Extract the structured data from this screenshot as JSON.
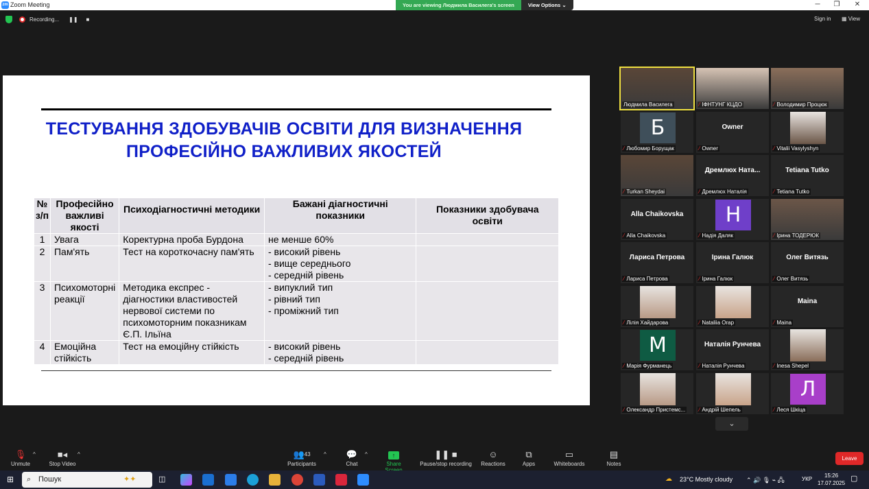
{
  "window": {
    "title": "Zoom Meeting",
    "logo": "zm",
    "minimize": "─",
    "restore": "❐",
    "close": "✕"
  },
  "viewing_banner": {
    "text": "You are viewing Людмила Василега's screen",
    "view_options": "View Options"
  },
  "top": {
    "recording": "Recording...",
    "sign_in": "Sign in",
    "view": "View"
  },
  "slide": {
    "title_line1": "ТЕСТУВАННЯ ЗДОБУВАЧІВ ОСВІТИ ДЛЯ ВИЗНАЧЕННЯ",
    "title_line2": "ПРОФЕСІЙНО ВАЖЛИВИХ ЯКОСТЕЙ",
    "headers": [
      "№ з/п",
      "Професійно важливі якості",
      "Психодіагностичні методики",
      "Бажані діагностичні показники",
      "Показники здобувача освіти"
    ],
    "rows": [
      {
        "n": "1",
        "quality": "Увага",
        "method": "Коректурна проба Бурдона",
        "target": "не менше 60%",
        "result": ""
      },
      {
        "n": "2",
        "quality": "Пам'ять",
        "method": "Тест на короткочасну пам'ять",
        "target": "- високий рівень\n- вище середнього\n- середній рівень",
        "result": ""
      },
      {
        "n": "3",
        "quality": "Психомоторні реакції",
        "method": "Методика експрес - діагностики властивостей нервової системи по психомоторним показникам Є.П. Ільїна",
        "target": "- випуклий тип\n- рівний тип\n- проміжний тип",
        "result": ""
      },
      {
        "n": "4",
        "quality": "Емоційна стійкість",
        "method": "Тест на емоційну стійкість",
        "target": "- високий рівень\n- середній рівень",
        "result": ""
      }
    ]
  },
  "participants_gallery": [
    {
      "name": "Людмила Василега",
      "type": "video",
      "active": true,
      "muted": false
    },
    {
      "name": "ІФНТУНГ КЦДО",
      "type": "video",
      "muted": true
    },
    {
      "name": "Володимир Процюк",
      "type": "video",
      "muted": true
    },
    {
      "name": "Любомир Борущак",
      "type": "avatar",
      "letter": "Б",
      "color": "#3f4f5a",
      "muted": true
    },
    {
      "name": "Owner",
      "type": "name",
      "big": "Owner",
      "muted": true
    },
    {
      "name": "Vitalii Vasylyshyn",
      "type": "photo",
      "muted": true
    },
    {
      "name": "Turkan Sheydai",
      "type": "video",
      "muted": true
    },
    {
      "name": "Дремлюх Наталія",
      "type": "name",
      "big": "Дремлюх  Ната...",
      "muted": true
    },
    {
      "name": "Tetiana Tutko",
      "type": "name",
      "big": "Tetiana Tutko",
      "muted": true
    },
    {
      "name": "Alla Chaikovska",
      "type": "name",
      "big": "Alla Chaikovska",
      "muted": true
    },
    {
      "name": "Надія Даляк",
      "type": "avatar",
      "letter": "Н",
      "color": "#6f3fc9",
      "muted": true
    },
    {
      "name": "Ірина ТОДЕРЮК",
      "type": "video",
      "muted": true
    },
    {
      "name": "Лариса Петрова",
      "type": "name",
      "big": "Лариса Петрова",
      "muted": true
    },
    {
      "name": "Ірина Галюк",
      "type": "name",
      "big": "Ірина Галюк",
      "muted": true
    },
    {
      "name": "Олег Витязь",
      "type": "name",
      "big": "Олег Витязь",
      "muted": true
    },
    {
      "name": "Лілія Хайдарова",
      "type": "photo",
      "muted": true
    },
    {
      "name": "Nataliia Orap",
      "type": "photo",
      "muted": true
    },
    {
      "name": "Maina",
      "type": "name",
      "big": "Maina",
      "muted": true
    },
    {
      "name": "Марія Фурманець",
      "type": "avatar",
      "letter": "М",
      "color": "#0f5b43",
      "muted": true
    },
    {
      "name": "Наталія Рунчева",
      "type": "name",
      "big": "Наталія Рунчева",
      "muted": true
    },
    {
      "name": "Inesa Shepel",
      "type": "photo",
      "muted": true
    },
    {
      "name": "Олександр Пристемс...",
      "type": "photo",
      "muted": true
    },
    {
      "name": "Андрій Шепель",
      "type": "photo",
      "muted": true
    },
    {
      "name": "Леся Шкіца",
      "type": "avatar",
      "letter": "Л",
      "color": "#a83fc9",
      "muted": true
    }
  ],
  "toolbar": {
    "unmute": "Unmute",
    "stop_video": "Stop Video",
    "participants": "Participants",
    "participants_count": "43",
    "chat": "Chat",
    "share_screen": "Share Screen",
    "pause_recording": "Pause/stop recording",
    "reactions": "Reactions",
    "apps": "Apps",
    "whiteboards": "Whiteboards",
    "notes": "Notes",
    "leave": "Leave"
  },
  "taskbar": {
    "search_placeholder": "Пошук",
    "weather": "23°C  Mostly cloudy",
    "lang": "УКР",
    "time": "15:26",
    "date": "17.07.2025"
  },
  "colors": {
    "accent": "#2d8cff",
    "leave": "#e02828",
    "slide_title": "#1020c8",
    "share": "#23c552"
  }
}
